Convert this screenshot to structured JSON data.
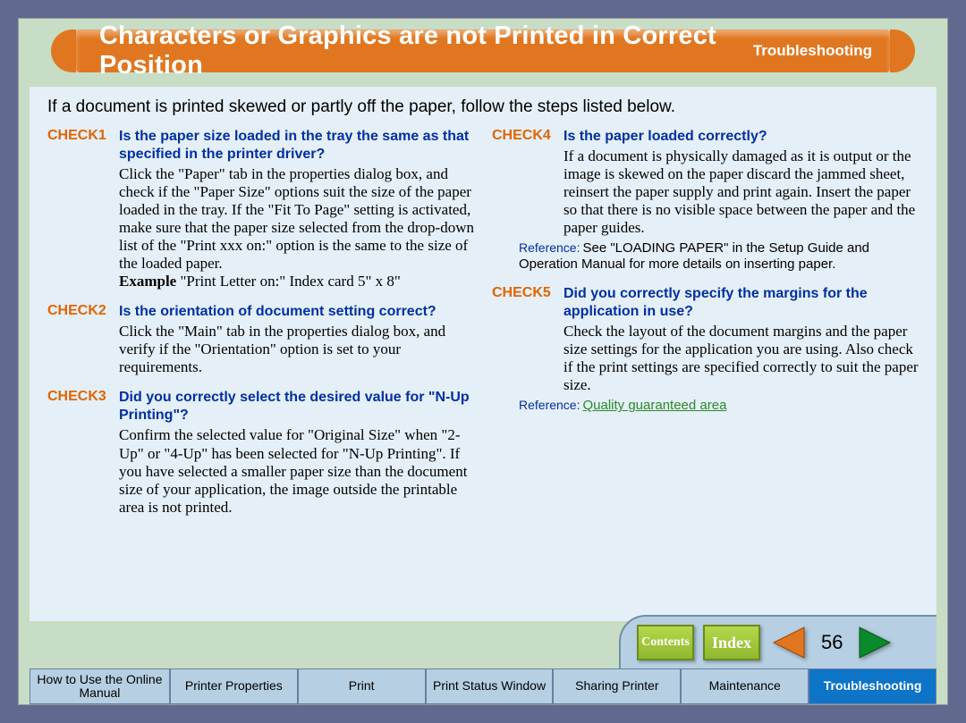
{
  "header": {
    "title": "Characters or Graphics are not Printed in Correct Position",
    "section": "Troubleshooting"
  },
  "intro": "If a document is printed skewed or partly off the paper, follow the steps listed below.",
  "left": [
    {
      "num": "CHECK1",
      "q": "Is the paper size loaded in the tray the same as that specified in the printer driver?",
      "body": "Click the \"Paper\" tab in the properties dialog box, and check if the \"Paper Size\" options suit the size of the paper loaded in the tray. If the \"Fit To Page\" setting is activated, make sure that the paper size selected from the drop-down list of the \"Print xxx on:\" option is the same to the size of the loaded paper.",
      "example_label": "Example",
      "example_text": " \"Print Letter on:\" Index card 5\" x 8\""
    },
    {
      "num": "CHECK2",
      "q": "Is the orientation of document setting correct?",
      "body": "Click the \"Main\" tab in the properties dialog box, and verify if the \"Orientation\" option is set to your requirements."
    },
    {
      "num": "CHECK3",
      "q": "Did you correctly select the desired value for \"N-Up Printing\"?",
      "body": "Confirm the selected value for \"Original Size\" when \"2-Up\" or \"4-Up\" has been selected for \"N-Up Printing\". If you have selected a smaller paper size than the document size of your application, the image outside the printable area is not printed."
    }
  ],
  "right": [
    {
      "num": "CHECK4",
      "q": "Is the paper loaded correctly?",
      "body": "If a document is physically damaged as it is output or the image is skewed on the paper discard the jammed sheet, reinsert the paper supply and print again. Insert the paper so that there is no visible space between the paper and the paper guides.",
      "ref_label": "Reference:",
      "ref_text": "See \"LOADING PAPER\" in the Setup Guide and Operation Manual for more details on inserting paper."
    },
    {
      "num": "CHECK5",
      "q": "Did you correctly specify the margins for the application in use?",
      "body": "Check the layout of the document margins and the paper size settings for the application you are using. Also check if the print settings are specified correctly to suit the paper size.",
      "ref_label": "Reference:",
      "ref_link": "Quality guaranteed area"
    }
  ],
  "nav": {
    "contents": "Contents",
    "index": "Index",
    "page": "56"
  },
  "tabs": [
    "How to Use the Online Manual",
    "Printer Properties",
    "Print",
    "Print Status Window",
    "Sharing Printer",
    "Maintenance",
    "Troubleshooting"
  ]
}
